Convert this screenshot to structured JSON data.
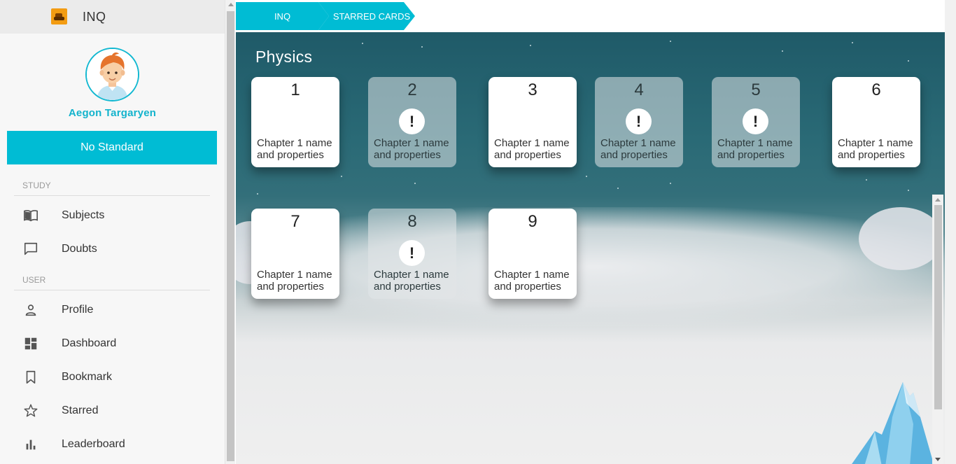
{
  "app": {
    "title": "INQ"
  },
  "user": {
    "name": "Aegon Targaryen",
    "standard_button": "No Standard"
  },
  "sidebar": {
    "sections": [
      {
        "label": "STUDY",
        "items": [
          {
            "label": "Subjects",
            "icon": "book-icon"
          },
          {
            "label": "Doubts",
            "icon": "chat-icon"
          }
        ]
      },
      {
        "label": "USER",
        "items": [
          {
            "label": "Profile",
            "icon": "person-icon"
          },
          {
            "label": "Dashboard",
            "icon": "dashboard-icon"
          },
          {
            "label": "Bookmark",
            "icon": "bookmark-icon"
          },
          {
            "label": "Starred",
            "icon": "star-icon"
          },
          {
            "label": "Leaderboard",
            "icon": "bar-chart-icon"
          }
        ]
      }
    ]
  },
  "breadcrumbs": [
    "INQ",
    "STARRED CARDS"
  ],
  "subject": {
    "title": "Physics"
  },
  "cards": [
    {
      "number": "1",
      "chapter": "Chapter 1 name and properties",
      "alert": false
    },
    {
      "number": "2",
      "chapter": "Chapter 1 name and properties",
      "alert": true
    },
    {
      "number": "3",
      "chapter": "Chapter 1 name and properties",
      "alert": false
    },
    {
      "number": "4",
      "chapter": "Chapter 1 name and properties",
      "alert": true
    },
    {
      "number": "5",
      "chapter": "Chapter 1 name and properties",
      "alert": true
    },
    {
      "number": "6",
      "chapter": "Chapter 1 name and properties",
      "alert": false
    },
    {
      "number": "7",
      "chapter": "Chapter 1 name and properties",
      "alert": false
    },
    {
      "number": "8",
      "chapter": "Chapter 1 name and properties",
      "alert": true
    },
    {
      "number": "9",
      "chapter": "Chapter 1 name and properties",
      "alert": false
    }
  ],
  "colors": {
    "accent": "#00bcd4",
    "username": "#13b3cc"
  }
}
